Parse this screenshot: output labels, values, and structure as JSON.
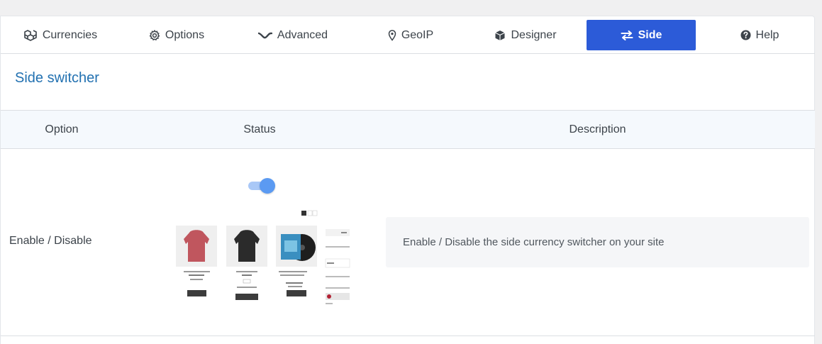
{
  "tabs": [
    {
      "label": "Currencies",
      "icon": "cubes-icon"
    },
    {
      "label": "Options",
      "icon": "gear-icon"
    },
    {
      "label": "Advanced",
      "icon": "wave-icon"
    },
    {
      "label": "GeoIP",
      "icon": "map-pin-icon"
    },
    {
      "label": "Designer",
      "icon": "box-icon"
    },
    {
      "label": "Side",
      "icon": "switch-arrows-icon",
      "active": true
    },
    {
      "label": "Help",
      "icon": "question-circle-icon"
    }
  ],
  "section": {
    "title": "Side switcher"
  },
  "table": {
    "headers": [
      "Option",
      "Status",
      "Description"
    ],
    "rows": [
      {
        "option": "Enable / Disable",
        "status": {
          "enabled": true
        },
        "description": "Enable / Disable the side currency switcher on your site"
      }
    ]
  },
  "colors": {
    "accent": "#2c5bd8",
    "title": "#2271b1",
    "toggle_on": "#5b9af2"
  }
}
